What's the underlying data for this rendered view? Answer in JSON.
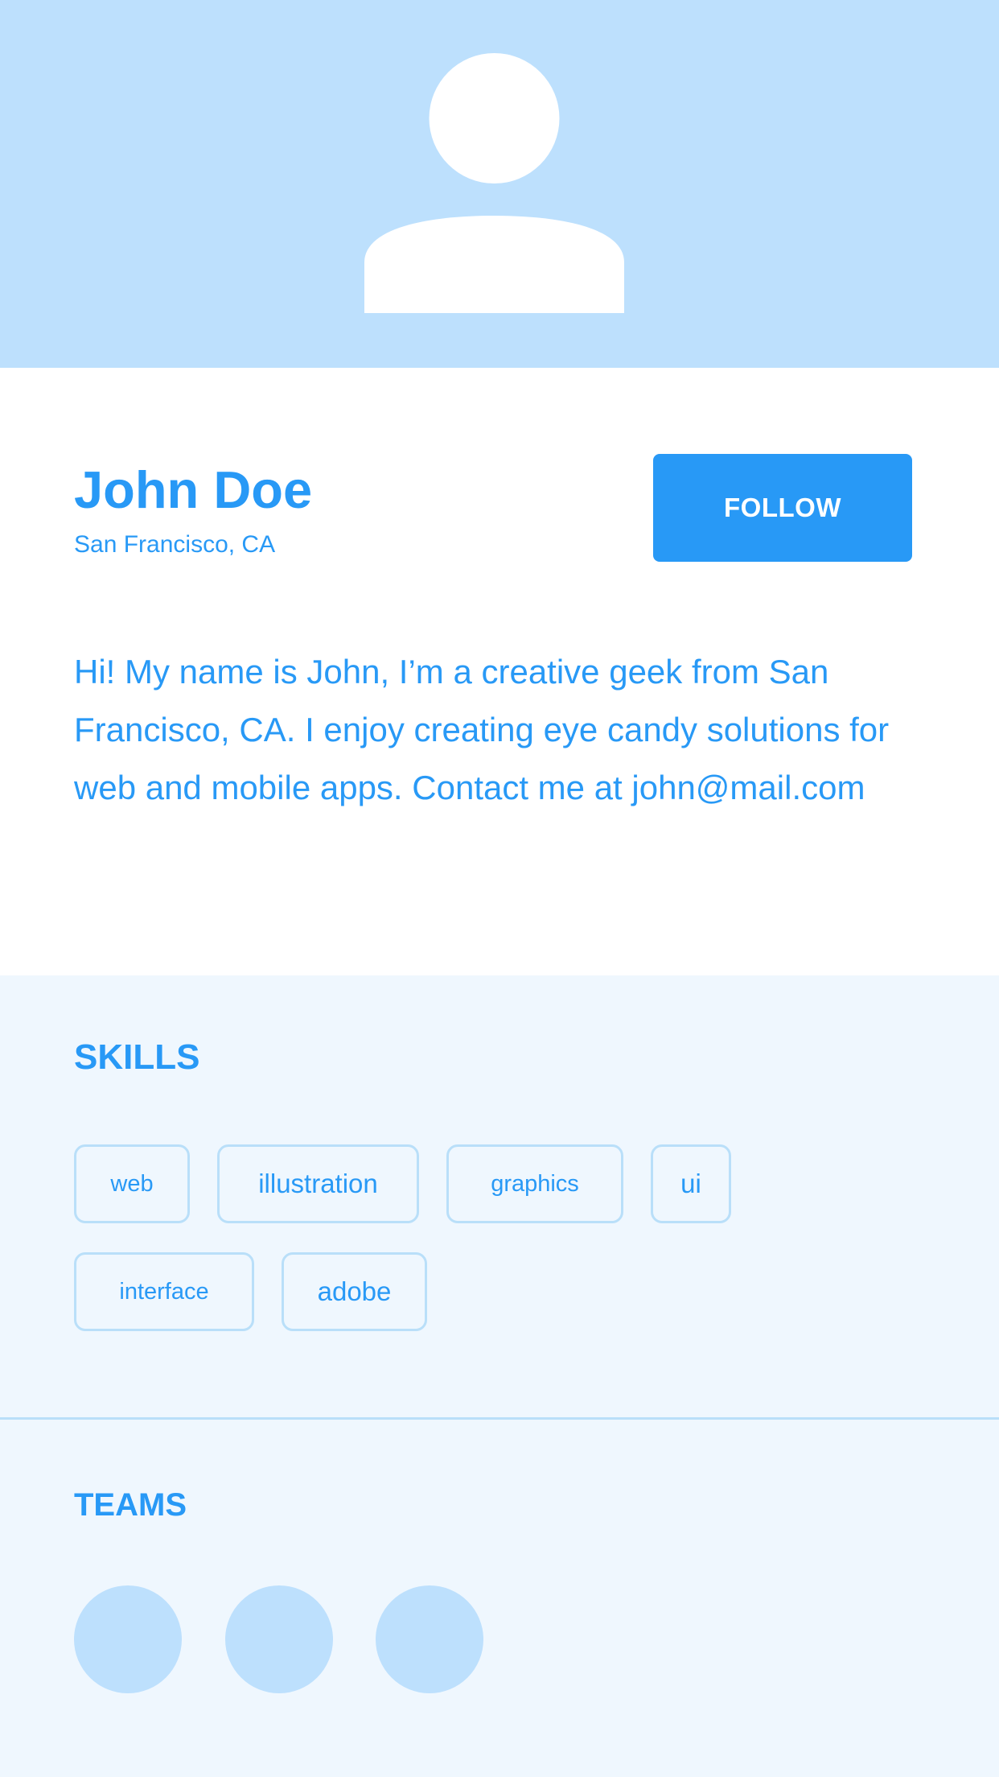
{
  "profile": {
    "name": "John Doe",
    "location": "San Francisco, CA",
    "follow_label": "FOLLOW",
    "bio": "Hi! My name is John, I’m a creative geek from San Francisco, CA. I enjoy creating eye candy solutions for web and mobile apps. Contact me at john@mail.com"
  },
  "skills": {
    "title": "SKILLS",
    "tags": [
      "web",
      "illustration",
      "graphics",
      "ui",
      "interface",
      "adobe"
    ]
  },
  "teams": {
    "title": "TEAMS",
    "count": 3
  },
  "colors": {
    "accent": "#2899f6",
    "header_bg": "#bde0fd",
    "section_bg": "#eff7fe",
    "tag_border": "#b9dff9"
  },
  "icons": {
    "avatar": "user-silhouette-icon"
  }
}
